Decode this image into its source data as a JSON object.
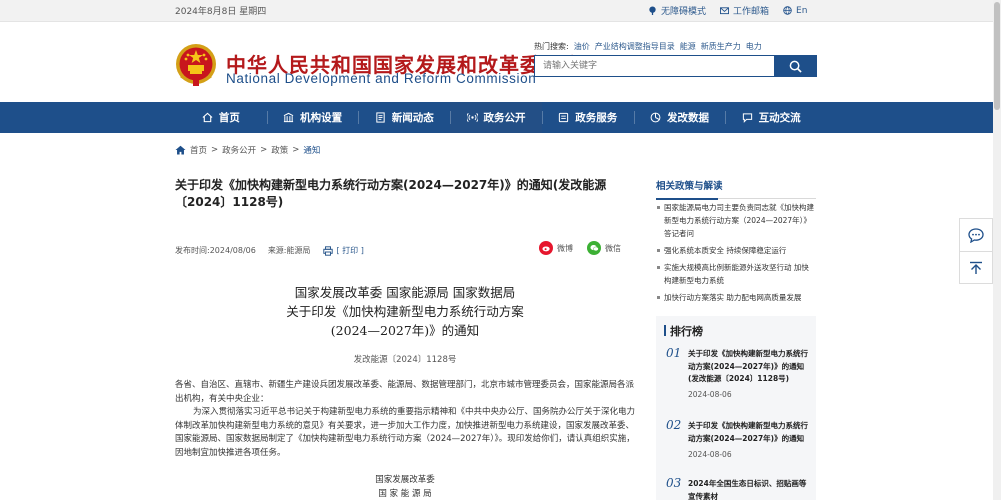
{
  "topbar": {
    "date": "2024年8月8日 星期四",
    "accessibility": "无障碍模式",
    "webmail": "工作邮箱",
    "lang": "En"
  },
  "header": {
    "title_cn": "中华人民共和国国家发展和改革委员会",
    "title_en": "National Development and Reform Commission",
    "hot_label": "热门搜索:",
    "hot_keywords": [
      "油价",
      "产业结构调整指导目录",
      "能源",
      "新质生产力",
      "电力"
    ],
    "search_placeholder": "请输入关键字"
  },
  "nav": {
    "items": [
      {
        "label": "首页",
        "icon": "home-icon"
      },
      {
        "label": "机构设置",
        "icon": "building-icon"
      },
      {
        "label": "新闻动态",
        "icon": "news-icon"
      },
      {
        "label": "政务公开",
        "icon": "broadcast-icon"
      },
      {
        "label": "政务服务",
        "icon": "service-icon"
      },
      {
        "label": "发改数据",
        "icon": "pie-chart-icon"
      },
      {
        "label": "互动交流",
        "icon": "chat-icon"
      }
    ],
    "active_index": 3
  },
  "breadcrumb": {
    "items": [
      "首页",
      "政务公开",
      "政策",
      "通知"
    ],
    "sep": ">"
  },
  "article": {
    "title": "关于印发《加快构建新型电力系统行动方案(2024—2027年)》的通知(发改能源〔2024〕1128号)",
    "publish_label": "发布时间:",
    "publish_date": "2024/08/06",
    "source_label": "来源:",
    "source": "能源局",
    "print": "[ 打印 ]",
    "share_weibo": "微博",
    "share_wechat": "微信",
    "doc_head_line1": "国家发展改革委 国家能源局 国家数据局",
    "doc_head_line2": "关于印发《加快构建新型电力系统行动方案",
    "doc_head_line3": "(2024—2027年)》的通知",
    "doc_no": "发改能源〔2024〕1128号",
    "para1": "各省、自治区、直辖市、新疆生产建设兵团发展改革委、能源局、数据管理部门，北京市城市管理委员会，国家能源局各派出机构，有关中央企业：",
    "para2": "为深入贯彻落实习近平总书记关于构建新型电力系统的重要指示精神和《中共中央办公厅、国务院办公厅关于深化电力体制改革加快构建新型电力系统的意见》有关要求，进一步加大工作力度，加快推进新型电力系统建设，国家发展改革委、国家能源局、国家数据局制定了《加快构建新型电力系统行动方案（2024—2027年）》。现印发给你们，请认真组织实施，因地制宜加快推进各项任务。",
    "sign1": "国家发展改革委",
    "sign2": "国 家 能 源 局"
  },
  "sidebar": {
    "related_title": "相关政策与解读",
    "related": [
      "国家能源局电力司主要负责同志就《加快构建新型电力系统行动方案（2024—2027年）》答记者问",
      "强化系统本质安全 持续保障稳定运行",
      "实施大规模高比例新能源外送攻坚行动 加快构建新型电力系统",
      "加快行动方案落实 助力配电网高质量发展"
    ],
    "rank_title": "排行榜",
    "rank": [
      {
        "no": "01",
        "title": "关于印发《加快构建新型电力系统行动方案(2024—2027年)》的通知(发改能源〔2024〕1128号)",
        "date": "2024-08-06"
      },
      {
        "no": "02",
        "title": "关于印发《加快构建新型电力系统行动方案(2024—2027年)》的通知",
        "date": "2024-08-06"
      },
      {
        "no": "03",
        "title": "2024年全国生态日标识、招贴画等宣传素材",
        "date": ""
      }
    ]
  },
  "colors": {
    "brand_blue": "#1e4f8a",
    "brand_red": "#b4191b"
  }
}
